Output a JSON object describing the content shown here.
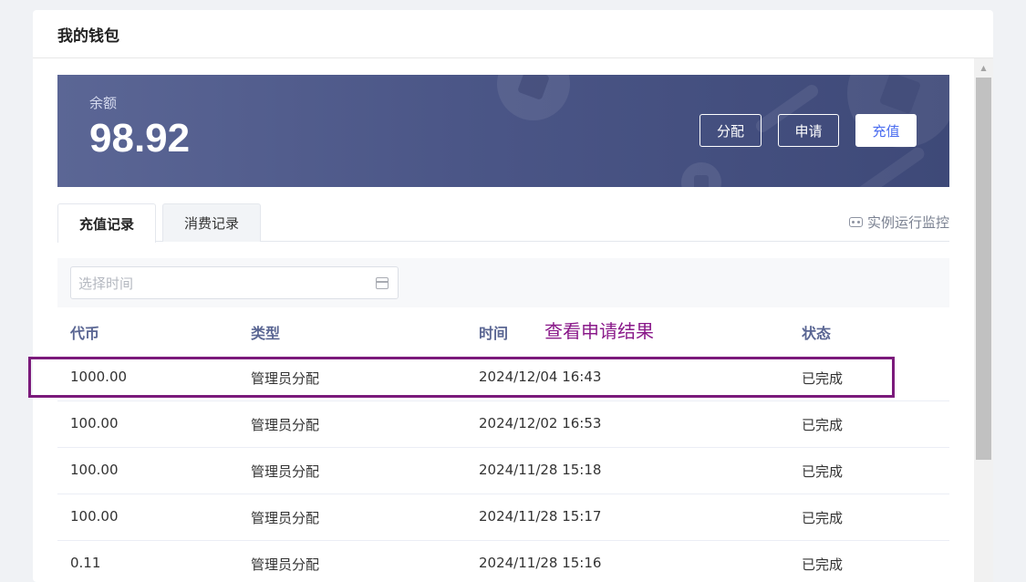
{
  "panel": {
    "title": "我的钱包"
  },
  "balance": {
    "label": "余额",
    "value": "98.92"
  },
  "actions": {
    "distribute": "分配",
    "apply": "申请",
    "recharge": "充值"
  },
  "tabs": [
    {
      "label": "充值记录",
      "active": true
    },
    {
      "label": "消费记录",
      "active": false
    }
  ],
  "monitor_link": {
    "label": "实例运行监控",
    "icon": "monitor-icon"
  },
  "filter": {
    "date_placeholder": "选择时间",
    "icon": "calendar-icon"
  },
  "table": {
    "headers": [
      "代币",
      "类型",
      "时间",
      "状态"
    ],
    "annotation": "查看申请结果",
    "rows": [
      [
        "1000.00",
        "管理员分配",
        "2024/12/04 16:43",
        "已完成"
      ],
      [
        "100.00",
        "管理员分配",
        "2024/12/02 16:53",
        "已完成"
      ],
      [
        "100.00",
        "管理员分配",
        "2024/11/28 15:18",
        "已完成"
      ],
      [
        "100.00",
        "管理员分配",
        "2024/11/28 15:17",
        "已完成"
      ],
      [
        "0.11",
        "管理员分配",
        "2024/11/28 15:16",
        "已完成"
      ]
    ]
  },
  "colors": {
    "banner_start": "#5b6695",
    "banner_end": "#3e4978",
    "header_text": "#5a6693",
    "annotation": "#8a1a8a",
    "recharge_text": "#4a6cf0"
  }
}
